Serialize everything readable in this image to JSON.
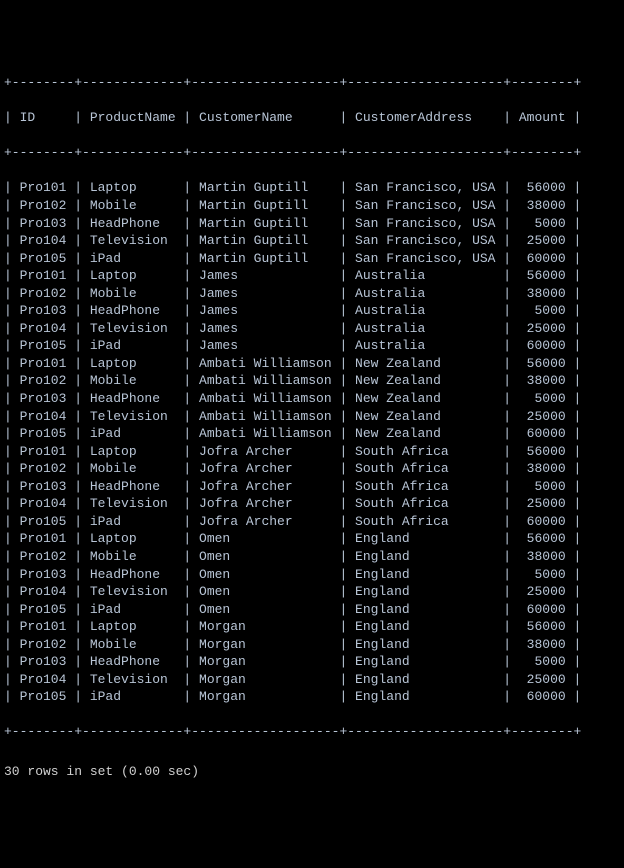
{
  "ruler": "+--------+-------------+-------------------+--------------------+--------+",
  "headers": {
    "id": "ID",
    "productName": "ProductName",
    "customerName": "CustomerName",
    "customerAddress": "CustomerAddress",
    "amount": "Amount"
  },
  "rows": [
    {
      "id": "Pro101",
      "productName": "Laptop",
      "customerName": "Martin Guptill",
      "customerAddress": "San Francisco, USA",
      "amount": "56000"
    },
    {
      "id": "Pro102",
      "productName": "Mobile",
      "customerName": "Martin Guptill",
      "customerAddress": "San Francisco, USA",
      "amount": "38000"
    },
    {
      "id": "Pro103",
      "productName": "HeadPhone",
      "customerName": "Martin Guptill",
      "customerAddress": "San Francisco, USA",
      "amount": "5000"
    },
    {
      "id": "Pro104",
      "productName": "Television",
      "customerName": "Martin Guptill",
      "customerAddress": "San Francisco, USA",
      "amount": "25000"
    },
    {
      "id": "Pro105",
      "productName": "iPad",
      "customerName": "Martin Guptill",
      "customerAddress": "San Francisco, USA",
      "amount": "60000"
    },
    {
      "id": "Pro101",
      "productName": "Laptop",
      "customerName": "James",
      "customerAddress": "Australia",
      "amount": "56000"
    },
    {
      "id": "Pro102",
      "productName": "Mobile",
      "customerName": "James",
      "customerAddress": "Australia",
      "amount": "38000"
    },
    {
      "id": "Pro103",
      "productName": "HeadPhone",
      "customerName": "James",
      "customerAddress": "Australia",
      "amount": "5000"
    },
    {
      "id": "Pro104",
      "productName": "Television",
      "customerName": "James",
      "customerAddress": "Australia",
      "amount": "25000"
    },
    {
      "id": "Pro105",
      "productName": "iPad",
      "customerName": "James",
      "customerAddress": "Australia",
      "amount": "60000"
    },
    {
      "id": "Pro101",
      "productName": "Laptop",
      "customerName": "Ambati Williamson",
      "customerAddress": "New Zealand",
      "amount": "56000"
    },
    {
      "id": "Pro102",
      "productName": "Mobile",
      "customerName": "Ambati Williamson",
      "customerAddress": "New Zealand",
      "amount": "38000"
    },
    {
      "id": "Pro103",
      "productName": "HeadPhone",
      "customerName": "Ambati Williamson",
      "customerAddress": "New Zealand",
      "amount": "5000"
    },
    {
      "id": "Pro104",
      "productName": "Television",
      "customerName": "Ambati Williamson",
      "customerAddress": "New Zealand",
      "amount": "25000"
    },
    {
      "id": "Pro105",
      "productName": "iPad",
      "customerName": "Ambati Williamson",
      "customerAddress": "New Zealand",
      "amount": "60000"
    },
    {
      "id": "Pro101",
      "productName": "Laptop",
      "customerName": "Jofra Archer",
      "customerAddress": "South Africa",
      "amount": "56000"
    },
    {
      "id": "Pro102",
      "productName": "Mobile",
      "customerName": "Jofra Archer",
      "customerAddress": "South Africa",
      "amount": "38000"
    },
    {
      "id": "Pro103",
      "productName": "HeadPhone",
      "customerName": "Jofra Archer",
      "customerAddress": "South Africa",
      "amount": "5000"
    },
    {
      "id": "Pro104",
      "productName": "Television",
      "customerName": "Jofra Archer",
      "customerAddress": "South Africa",
      "amount": "25000"
    },
    {
      "id": "Pro105",
      "productName": "iPad",
      "customerName": "Jofra Archer",
      "customerAddress": "South Africa",
      "amount": "60000"
    },
    {
      "id": "Pro101",
      "productName": "Laptop",
      "customerName": "Omen",
      "customerAddress": "England",
      "amount": "56000"
    },
    {
      "id": "Pro102",
      "productName": "Mobile",
      "customerName": "Omen",
      "customerAddress": "England",
      "amount": "38000"
    },
    {
      "id": "Pro103",
      "productName": "HeadPhone",
      "customerName": "Omen",
      "customerAddress": "England",
      "amount": "5000"
    },
    {
      "id": "Pro104",
      "productName": "Television",
      "customerName": "Omen",
      "customerAddress": "England",
      "amount": "25000"
    },
    {
      "id": "Pro105",
      "productName": "iPad",
      "customerName": "Omen",
      "customerAddress": "England",
      "amount": "60000"
    },
    {
      "id": "Pro101",
      "productName": "Laptop",
      "customerName": "Morgan",
      "customerAddress": "England",
      "amount": "56000"
    },
    {
      "id": "Pro102",
      "productName": "Mobile",
      "customerName": "Morgan",
      "customerAddress": "England",
      "amount": "38000"
    },
    {
      "id": "Pro103",
      "productName": "HeadPhone",
      "customerName": "Morgan",
      "customerAddress": "England",
      "amount": "5000"
    },
    {
      "id": "Pro104",
      "productName": "Television",
      "customerName": "Morgan",
      "customerAddress": "England",
      "amount": "25000"
    },
    {
      "id": "Pro105",
      "productName": "iPad",
      "customerName": "Morgan",
      "customerAddress": "England",
      "amount": "60000"
    }
  ],
  "status": "30 rows in set (0.00 sec)"
}
